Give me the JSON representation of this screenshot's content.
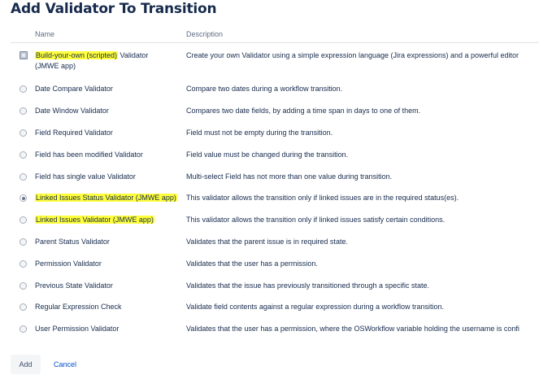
{
  "dialog": {
    "title": "Add Validator To Transition",
    "columns": {
      "name": "Name",
      "description": "Description"
    },
    "highlight_color": "#ffff3c",
    "validators": [
      {
        "name_highlight": "Build-your-own (scripted)",
        "name_rest": " Validator",
        "name_line2": "(JMWE app)",
        "description": "Create your own Validator using a simple expression language (Jira expressions) and a powerful editor",
        "selected": false
      },
      {
        "name": "Date Compare Validator",
        "description": "Compare two dates during a workflow transition.",
        "selected": false
      },
      {
        "name": "Date Window Validator",
        "description": "Compares two date fields, by adding a time span in days to one of them.",
        "selected": false
      },
      {
        "name": "Field Required Validator",
        "description": "Field must not be empty during the transition.",
        "selected": false
      },
      {
        "name": "Field has been modified Validator",
        "description": "Field value must be changed during the transition.",
        "selected": false
      },
      {
        "name": "Field has single value Validator",
        "description": "Multi-select Field has not more than one value during transition.",
        "selected": false
      },
      {
        "name": "Linked Issues Status Validator (JMWE app)",
        "description": "This validator allows the transition only if linked issues are in the required status(es).",
        "selected": true
      },
      {
        "name": "Linked Issues Validator (JMWE app)",
        "description": "This validator allows the transition only if linked issues satisfy certain conditions.",
        "selected": false
      },
      {
        "name": "Parent Status Validator",
        "description": "Validates that the parent issue is in required state.",
        "selected": false
      },
      {
        "name": "Permission Validator",
        "description": "Validates that the user has a permission.",
        "selected": false
      },
      {
        "name": "Previous State Validator",
        "description": "Validates that the issue has previously transitioned through a specific state.",
        "selected": false
      },
      {
        "name": "Regular Expression Check",
        "description": "Validate field contents against a regular expression during a workflow transition.",
        "selected": false
      },
      {
        "name": "User Permission Validator",
        "description": "Validates that the user has a permission, where the OSWorkflow variable holding the username is confi",
        "selected": false
      }
    ],
    "buttons": {
      "add": "Add",
      "cancel": "Cancel"
    }
  }
}
